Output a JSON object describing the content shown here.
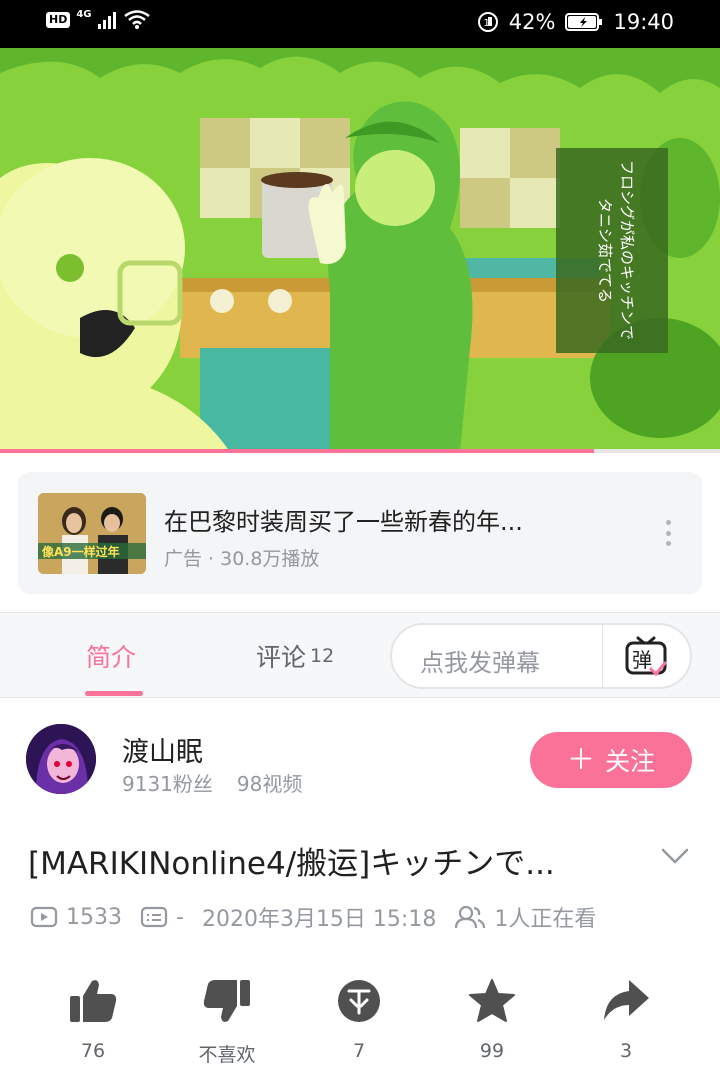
{
  "status_bar": {
    "hd": "HD",
    "network": "4G",
    "battery_percent": "42%",
    "time": "19:40"
  },
  "video": {
    "caption_lines": [
      "フロシグが私のキッチンで",
      "タニシ茹でてる"
    ],
    "progress_fraction": 0.825,
    "accent_color": "#fb7299"
  },
  "ad": {
    "title": "在巴黎时装周买了一些新春的年...",
    "meta": "广告 · 30.8万播放",
    "thumb_text": "像A9一样过年"
  },
  "tabs": {
    "intro": "简介",
    "comments": "评论",
    "comment_count": "12",
    "danmaku_placeholder": "点我发弹幕",
    "danmaku_icon_char": "弹"
  },
  "uploader": {
    "name": "渡山眠",
    "fans": "9131粉丝",
    "videos": "98视频",
    "follow_label": "关注",
    "follow_plus": "＋"
  },
  "video_info": {
    "title": "[MARIKINonline4/搬运]キッチンで...",
    "views": "1533",
    "danmaku_count": "-",
    "date": "2020年3月15日 15:18",
    "watching": "1人正在看"
  },
  "actions": {
    "like": "76",
    "dislike": "不喜欢",
    "coin": "7",
    "favorite": "99",
    "share": "3"
  },
  "colors": {
    "pink": "#fb7299",
    "gray_text": "#9499a0",
    "icon_gray": "#505050"
  }
}
